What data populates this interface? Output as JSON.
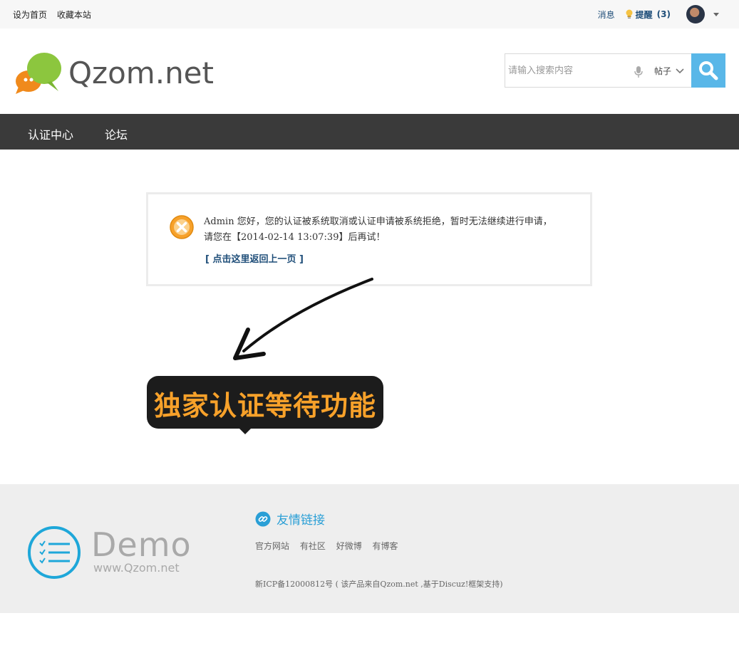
{
  "topbar": {
    "set_home": "设为首页",
    "bookmark": "收藏本站",
    "messages": "消息",
    "remind": "提醒",
    "remind_count": "(3)"
  },
  "header": {
    "logo_text": "Qzom.net",
    "search_placeholder": "请输入搜索内容",
    "search_scope": "帖子"
  },
  "nav": {
    "items": [
      "认证中心",
      "论坛"
    ]
  },
  "message": {
    "line1": "Admin 您好，您的认证被系统取消或认证申请被系统拒绝，暂时无法继续进行申请，",
    "line2": "请您在【2014-02-14 13:07:39】后再试！",
    "back_link": "[ 点击这里返回上一页 ]"
  },
  "banner": {
    "text": "独家认证等待功能"
  },
  "footer": {
    "demo_word": "Demo",
    "demo_url": "www.Qzom.net",
    "links_title": "友情链接",
    "links": [
      "官方网站",
      "有社区",
      "好微博",
      "有博客"
    ],
    "icp": "新ICP备12000812号 ( 该产品来自Qzom.net ,基于Discuz!框架支持)"
  },
  "colors": {
    "nav_bg": "#3a3a3a",
    "search_button": "#59b7e8",
    "link_blue": "#1f4e79",
    "banner_text": "#f7a12a",
    "footer_bg": "#eeeeee",
    "footer_accent": "#2a9fd6"
  }
}
